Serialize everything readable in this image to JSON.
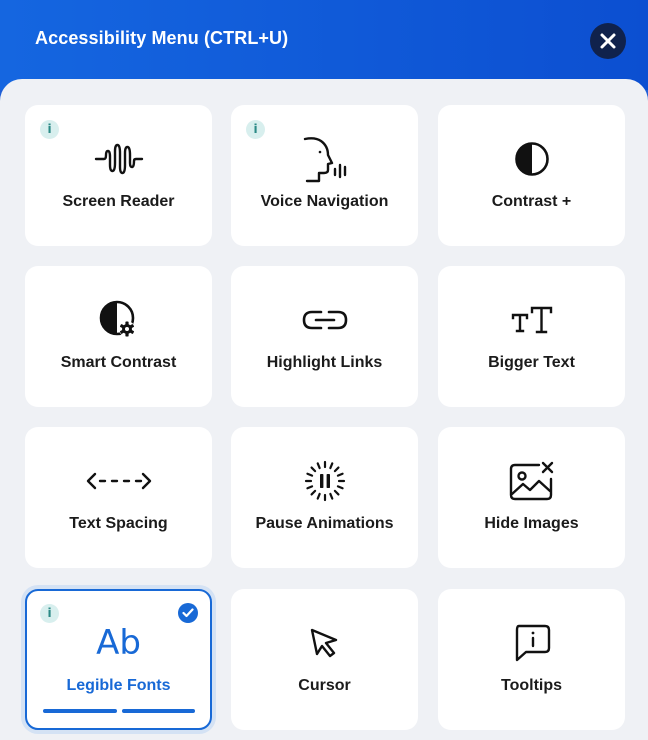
{
  "header": {
    "title": "Accessibility Menu (CTRL+U)",
    "close_icon": "close-icon"
  },
  "colors": {
    "header_blue": "#0c4fd1",
    "accent": "#1869d6",
    "info_badge_bg": "#d8efee",
    "close_bg": "#10224c"
  },
  "info_badge_text": "i",
  "tiles": [
    {
      "label": "Screen Reader",
      "icon": "sound-wave-icon",
      "has_info": true,
      "active": false
    },
    {
      "label": "Voice Navigation",
      "icon": "speaking-head-icon",
      "has_info": true,
      "active": false
    },
    {
      "label": "Contrast +",
      "icon": "contrast-icon",
      "has_info": false,
      "active": false
    },
    {
      "label": "Smart Contrast",
      "icon": "contrast-gear-icon",
      "has_info": false,
      "active": false
    },
    {
      "label": "Highlight Links",
      "icon": "link-icon",
      "has_info": false,
      "active": false
    },
    {
      "label": "Bigger Text",
      "icon": "text-size-icon",
      "has_info": false,
      "active": false
    },
    {
      "label": "Text Spacing",
      "icon": "horizontal-arrows-icon",
      "has_info": false,
      "active": false
    },
    {
      "label": "Pause Animations",
      "icon": "pause-circle-icon",
      "has_info": false,
      "active": false
    },
    {
      "label": "Hide Images",
      "icon": "image-off-icon",
      "has_info": false,
      "active": false
    },
    {
      "label": "Legible Fonts",
      "icon": "font-ab-icon",
      "icon_text": "Ab",
      "has_info": true,
      "active": true,
      "level": {
        "current": 2,
        "max": 2
      }
    },
    {
      "label": "Cursor",
      "icon": "cursor-icon",
      "has_info": false,
      "active": false
    },
    {
      "label": "Tooltips",
      "icon": "tooltip-icon",
      "has_info": false,
      "active": false
    }
  ]
}
